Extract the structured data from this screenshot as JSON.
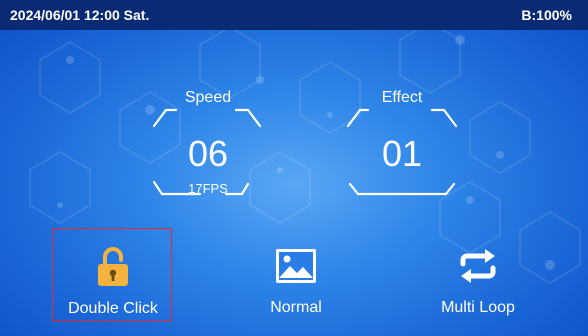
{
  "status_bar": {
    "datetime": "2024/06/01 12:00 Sat.",
    "battery": "B:100%"
  },
  "gauges": {
    "speed": {
      "label": "Speed",
      "value": "06",
      "sub": "17FPS"
    },
    "effect": {
      "label": "Effect",
      "value": "01",
      "sub": ""
    }
  },
  "buttons": {
    "lock": {
      "label": "Double Click",
      "icon": "lock-icon",
      "selected": true
    },
    "normal": {
      "label": "Normal",
      "icon": "image-icon",
      "selected": false
    },
    "loop": {
      "label": "Multi Loop",
      "icon": "loop-icon",
      "selected": false
    }
  },
  "colors": {
    "status_bar_bg": "#0a2a73",
    "background": "#2f86e8",
    "lock_icon": "#f4b23e",
    "selection_border": "#e52b2b"
  }
}
